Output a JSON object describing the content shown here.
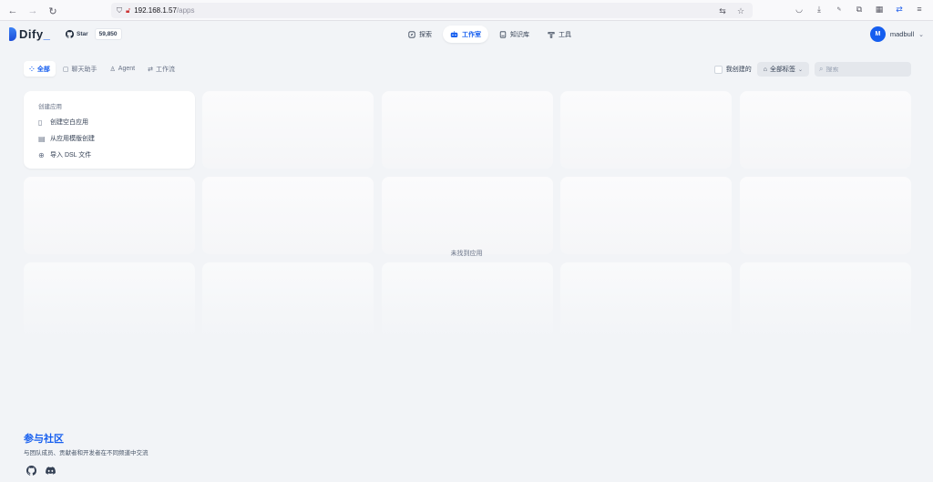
{
  "browser": {
    "url_host": "192.168.1.57",
    "url_path": "/apps"
  },
  "header": {
    "logo_text": "Dify",
    "logo_underscore": "_",
    "star_label": "Star",
    "star_count": "59,850",
    "nav": [
      {
        "label": "探索",
        "icon": "compass-icon"
      },
      {
        "label": "工作室",
        "icon": "robot-icon",
        "active": true
      },
      {
        "label": "知识库",
        "icon": "book-icon"
      },
      {
        "label": "工具",
        "icon": "hammer-icon"
      }
    ],
    "user_initial": "M",
    "user_name": "madbull"
  },
  "filters": {
    "tabs": [
      {
        "label": "全部",
        "icon": "grid-icon",
        "active": true
      },
      {
        "label": "聊天助手",
        "icon": "chat-icon"
      },
      {
        "label": "Agent",
        "icon": "agent-icon"
      },
      {
        "label": "工作流",
        "icon": "workflow-icon"
      }
    ],
    "mine_label": "我创建的",
    "tags_label": "全部标签",
    "search_placeholder": "搜索"
  },
  "create_card": {
    "title": "创建应用",
    "items": [
      {
        "label": "创建空白应用",
        "icon": "file-plus-icon"
      },
      {
        "label": "从应用模版创建",
        "icon": "template-icon"
      },
      {
        "label": "导入 DSL 文件",
        "icon": "import-icon"
      }
    ]
  },
  "empty_message": "未找到应用",
  "footer": {
    "title": "参与社区",
    "subtitle": "与团队成员、贡献者和开发者在不同频道中交流"
  },
  "colors": {
    "accent": "#155eef",
    "background": "#f2f4f7"
  }
}
